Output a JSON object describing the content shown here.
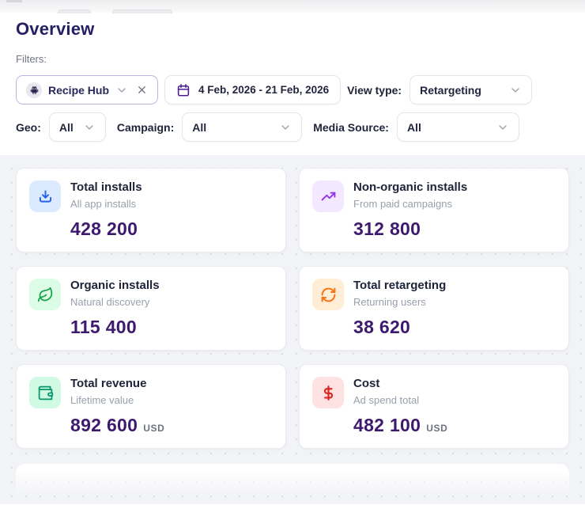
{
  "header": {
    "title": "Overview",
    "filters_label": "Filters:"
  },
  "filters": {
    "app_chip": {
      "icon": "android-icon",
      "value": "Recipe Hub"
    },
    "date_range": {
      "icon": "calendar-icon",
      "value": "4 Feb, 2026 - 21 Feb, 2026"
    },
    "view_type": {
      "label": "View type:",
      "value": "Retargeting"
    },
    "geo": {
      "label": "Geo:",
      "value": "All"
    },
    "campaign": {
      "label": "Campaign:",
      "value": "All"
    },
    "media_source": {
      "label": "Media Source:",
      "value": "All"
    }
  },
  "cards": [
    {
      "icon": "download-icon",
      "title": "Total installs",
      "subtitle": "All app installs",
      "value": "428 200",
      "unit": "",
      "icon_color": "#2563eb",
      "icon_bg": "#dbeafe"
    },
    {
      "icon": "trending-up-icon",
      "title": "Non-organic installs",
      "subtitle": "From paid campaigns",
      "value": "312 800",
      "unit": "",
      "icon_color": "#9333ea",
      "icon_bg": "#f3e8ff"
    },
    {
      "icon": "leaf-icon",
      "title": "Organic installs",
      "subtitle": "Natural discovery",
      "value": "115 400",
      "unit": "",
      "icon_color": "#16a34a",
      "icon_bg": "#dcfce7"
    },
    {
      "icon": "refresh-icon",
      "title": "Total retargeting",
      "subtitle": "Returning users",
      "value": "38 620",
      "unit": "",
      "icon_color": "#f97316",
      "icon_bg": "#ffedd5"
    },
    {
      "icon": "wallet-icon",
      "title": "Total revenue",
      "subtitle": "Lifetime value",
      "value": "892 600",
      "unit": "USD",
      "icon_color": "#059669",
      "icon_bg": "#d1fae5"
    },
    {
      "icon": "dollar-icon",
      "title": "Cost",
      "subtitle": "Ad spend total",
      "value": "482 100",
      "unit": "USD",
      "icon_color": "#dc2626",
      "icon_bg": "#fee2e2"
    }
  ],
  "colors": {
    "page_title": "#252063",
    "metric_value": "#3d1a6d",
    "app_chip_border": "#b9b5df",
    "panel_bg": "#f2f3f6"
  }
}
